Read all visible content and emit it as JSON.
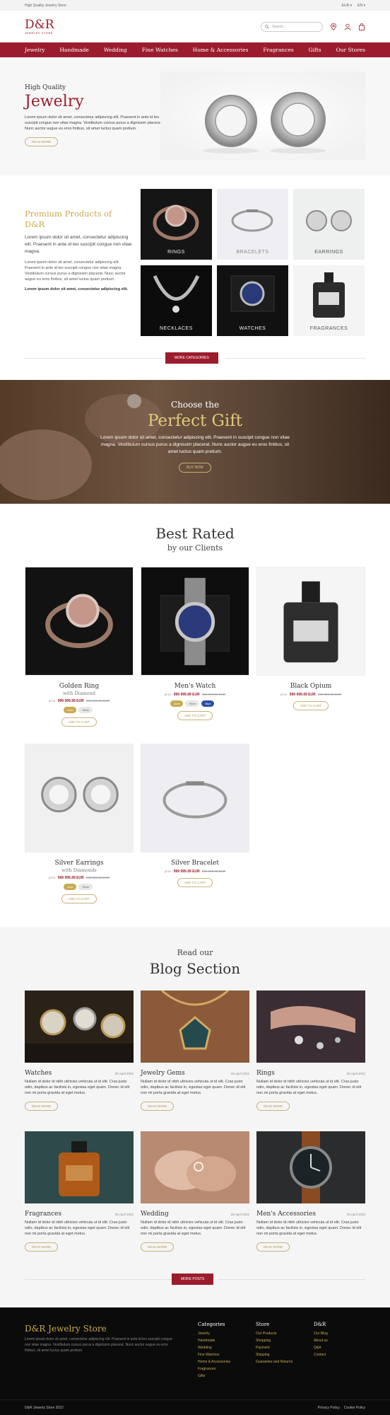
{
  "topbar": {
    "tagline": "High Quality Jewelry Store",
    "currency": "EUR",
    "language": "EN"
  },
  "header": {
    "logo": "D&R",
    "logo_sub": "JEWELRY STORE",
    "search_placeholder": "Search..."
  },
  "nav": [
    "Jewelry",
    "Handmade",
    "Wedding",
    "Fine Watches",
    "Home & Accessories",
    "Fragrances",
    "Gifts",
    "Our Stores"
  ],
  "hero": {
    "pre": "High Quality",
    "title": "Jewelry",
    "text": "Lorem ipsum dolor sit amet, consectetur adipiscing elit. Praesent in ante id leo suscipit congue non vitae magna. Vestibulum cursus purus a dignissim placerat. Nunc auctor augue eu eros finibus, sit amet luctus quam pretium.",
    "button": "Read more"
  },
  "premium": {
    "title": "Premium Products of D&R",
    "p1": "Lorem ipsum dolor sit amet, consectetur adipiscing elit. Praesent in ante id leo suscipit congue non vitae magna.",
    "p2": "Lorem ipsum dolor sit amet, consectetur adipiscing elit. Praesent in ante id leo suscipit congue non vitae magna. Vestibulum cursus purus a dignissim placerat. Nunc auctor augue eu eros finibus, sit amet luctus quam pretium.",
    "p3": "Lorem ipsum dolor sit amet, consectetur adipiscing elit.",
    "categories": [
      "RINGS",
      "BRACELETS",
      "EARRINGS",
      "NECKLACES",
      "WATCHES",
      "FRAGRANCES"
    ],
    "more_button": "More categories"
  },
  "gift": {
    "pre": "Choose the",
    "title": "Perfect Gift",
    "text": "Lorem ipsum dolor sit amet, consectetur adipiscing elit. Praesent in suscipit congue non vitae magna. Vestibulum cursus purus a dignissim placerat. Nunc auctor augue eu eros finibus, sit amet luctus quam pretium.",
    "button": "Buy now"
  },
  "best_rated": {
    "title": "Best Rated",
    "subtitle": "by our Clients",
    "products": [
      {
        "name": "Golden Ring",
        "sub": "with Diamond",
        "from": "price",
        "price": "999 999.99 EUR",
        "old": "999 999.99 EUR",
        "swatches": [
          "Gold",
          "Silver"
        ],
        "cta": "Add to cart"
      },
      {
        "name": "Men's Watch",
        "sub": "",
        "from": "price",
        "price": "999 999.99 EUR",
        "old": "999 999.99 EUR",
        "swatches": [
          "Gold",
          "Silver",
          "Blue"
        ],
        "cta": "Add to cart"
      },
      {
        "name": "Black Opium",
        "sub": "",
        "from": "price",
        "price": "999 999.99 EUR",
        "old": "999 999.99 EUR",
        "swatches": [],
        "cta": "Add to cart"
      },
      {
        "name": "Silver Earrings",
        "sub": "with Diamonds",
        "from": "price",
        "price": "999 999.99 EUR",
        "old": "999 999.99 EUR",
        "swatches": [
          "Gold",
          "Silver"
        ],
        "cta": "Add to cart"
      },
      {
        "name": "Silver Bracelet",
        "sub": "",
        "from": "price",
        "price": "999 999.99 EUR",
        "old": "999 999.99 EUR",
        "swatches": [],
        "cta": "Add to cart"
      }
    ]
  },
  "blog": {
    "pre": "Read our",
    "title": "Blog Section",
    "posts": [
      {
        "title": "Watches",
        "date": "25 April 2022",
        "text": "Nullam id dolor id nibh ultricies vehicula ut id elit. Cras justo odio, dapibus ac facilisis in, egestas eget quam. Donec id elit non mi porta gravida at eget metus.",
        "cta": "Read more"
      },
      {
        "title": "Jewelry Gems",
        "date": "25 April 2022",
        "text": "Nullam id dolor id nibh ultricies vehicula ut id elit. Cras justo odio, dapibus ac facilisis in, egestas eget quam. Donec id elit non mi porta gravida at eget metus.",
        "cta": "Read more"
      },
      {
        "title": "Rings",
        "date": "25 April 2022",
        "text": "Nullam id dolor id nibh ultricies vehicula ut id elit. Cras justo odio, dapibus ac facilisis in, egestas eget quam. Donec id elit non mi porta gravida at eget metus.",
        "cta": "Read more"
      },
      {
        "title": "Fragrances",
        "date": "25 April 2022",
        "text": "Nullam id dolor id nibh ultricies vehicula ut id elit. Cras justo odio, dapibus ac facilisis in, egestas eget quam. Donec id elit non mi porta gravida at eget metus.",
        "cta": "Read more"
      },
      {
        "title": "Wedding",
        "date": "25 April 2022",
        "text": "Nullam id dolor id nibh ultricies vehicula ut id elit. Cras justo odio, dapibus ac facilisis in, egestas eget quam. Donec id elit non mi porta gravida at eget metus.",
        "cta": "Read more"
      },
      {
        "title": "Men's Accessories",
        "date": "25 April 2022",
        "text": "Nullam id dolor id nibh ultricies vehicula ut id elit. Cras justo odio, dapibus ac facilisis in, egestas eget quam. Donec id elit non mi porta gravida at eget metus.",
        "cta": "Read more"
      }
    ],
    "more_button": "More posts"
  },
  "footer": {
    "brand": "D&R Jewelry Store",
    "desc": "Lorem ipsum dolor sit amet, consectetur adipiscing elit. Praesent in ante id leo suscipit congue non vitae magna. Vestibulum cursus purus a dignissim placerat. Nunc auctor augue eu eros finibus, sit amet luctus quam pretium.",
    "columns": [
      {
        "title": "Categories",
        "links": [
          "Jewelry",
          "Handmade",
          "Wedding",
          "Fine Watches",
          "Home & Accessories",
          "Fragrances",
          "Gifts"
        ]
      },
      {
        "title": "Store",
        "links": [
          "Our Products",
          "Shopping",
          "Payment",
          "Shipping",
          "Guarantee and Returns"
        ]
      },
      {
        "title": "D&R",
        "links": [
          "Our Blog",
          "About us",
          "Q&A",
          "Contact"
        ]
      }
    ],
    "copyright": "D&R Jewelry Store 2022",
    "privacy": "Privacy Policy",
    "cookie": "Cookie Policy"
  },
  "colors": {
    "brand": "#9b1c2c",
    "gold": "#c7a94f",
    "footer_bg": "#0b0b0b"
  }
}
